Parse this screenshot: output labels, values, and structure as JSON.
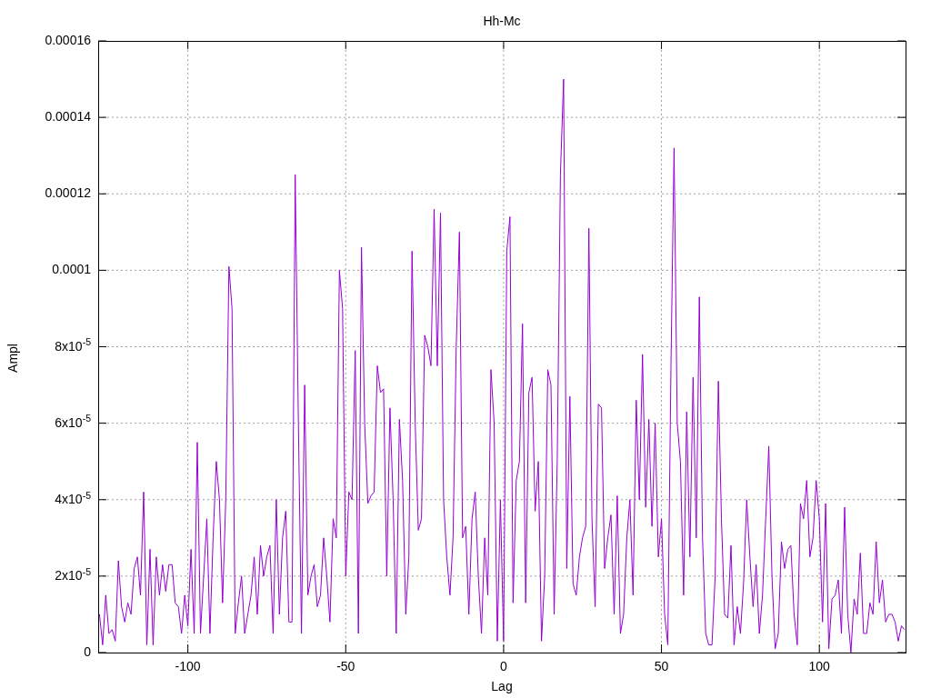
{
  "chart_data": {
    "type": "line",
    "title": "Hh-Mc",
    "xlabel": "Lag",
    "ylabel": "Ampl",
    "grid": true,
    "xlim": [
      -128,
      127
    ],
    "ylim": [
      0,
      0.00016
    ],
    "xticks": [
      -100,
      -50,
      0,
      50,
      100
    ],
    "yticks": [
      {
        "value": 0,
        "label": "0"
      },
      {
        "value": 2e-05,
        "label": "2x10$^{-5}$"
      },
      {
        "value": 4e-05,
        "label": "4x10$^{-5}$"
      },
      {
        "value": 6e-05,
        "label": "6x10$^{-5}$"
      },
      {
        "value": 8e-05,
        "label": "8x10$^{-5}$"
      },
      {
        "value": 0.0001,
        "label": "0.0001"
      },
      {
        "value": 0.00012,
        "label": "0.00012"
      },
      {
        "value": 0.00014,
        "label": "0.00014"
      },
      {
        "value": 0.00016,
        "label": "0.00016"
      }
    ],
    "x": [
      -128,
      -127,
      -126,
      -125,
      -124,
      -123,
      -122,
      -121,
      -120,
      -119,
      -118,
      -117,
      -116,
      -115,
      -114,
      -113,
      -112,
      -111,
      -110,
      -109,
      -108,
      -107,
      -106,
      -105,
      -104,
      -103,
      -102,
      -101,
      -100,
      -99,
      -98,
      -97,
      -96,
      -95,
      -94,
      -93,
      -92,
      -91,
      -90,
      -89,
      -88,
      -87,
      -86,
      -85,
      -84,
      -83,
      -82,
      -81,
      -80,
      -79,
      -78,
      -77,
      -76,
      -75,
      -74,
      -73,
      -72,
      -71,
      -70,
      -69,
      -68,
      -67,
      -66,
      -65,
      -64,
      -63,
      -62,
      -61,
      -60,
      -59,
      -58,
      -57,
      -56,
      -55,
      -54,
      -53,
      -52,
      -51,
      -50,
      -49,
      -48,
      -47,
      -46,
      -45,
      -44,
      -43,
      -42,
      -41,
      -40,
      -39,
      -38,
      -37,
      -36,
      -35,
      -34,
      -33,
      -32,
      -31,
      -30,
      -29,
      -28,
      -27,
      -26,
      -25,
      -24,
      -23,
      -22,
      -21,
      -20,
      -19,
      -18,
      -17,
      -16,
      -15,
      -14,
      -13,
      -12,
      -11,
      -10,
      -9,
      -8,
      -7,
      -6,
      -5,
      -4,
      -3,
      -2,
      -1,
      0,
      1,
      2,
      3,
      4,
      5,
      6,
      7,
      8,
      9,
      10,
      11,
      12,
      13,
      14,
      15,
      16,
      17,
      18,
      19,
      20,
      21,
      22,
      23,
      24,
      25,
      26,
      27,
      28,
      29,
      30,
      31,
      32,
      33,
      34,
      35,
      36,
      37,
      38,
      39,
      40,
      41,
      42,
      43,
      44,
      45,
      46,
      47,
      48,
      49,
      50,
      51,
      52,
      53,
      54,
      55,
      56,
      57,
      58,
      59,
      60,
      61,
      62,
      63,
      64,
      65,
      66,
      67,
      68,
      69,
      70,
      71,
      72,
      73,
      74,
      75,
      76,
      77,
      78,
      79,
      80,
      81,
      82,
      83,
      84,
      85,
      86,
      87,
      88,
      89,
      90,
      91,
      92,
      93,
      94,
      95,
      96,
      97,
      98,
      99,
      100,
      101,
      102,
      103,
      104,
      105,
      106,
      107,
      108,
      109,
      110,
      111,
      112,
      113,
      114,
      115,
      116,
      117,
      118,
      119,
      120,
      121,
      122,
      123,
      124,
      125,
      126,
      127
    ],
    "series": [
      {
        "color": "#9400d3",
        "values": [
          1e-05,
          2e-06,
          1.5e-05,
          5e-06,
          6e-06,
          3e-06,
          2.4e-05,
          1.2e-05,
          8e-06,
          1.3e-05,
          1e-05,
          2.2e-05,
          2.5e-05,
          1.5e-05,
          4.2e-05,
          2e-06,
          2.7e-05,
          2e-06,
          2.5e-05,
          1.5e-05,
          2.3e-05,
          1.6e-05,
          2.3e-05,
          2.3e-05,
          1.3e-05,
          1.2e-05,
          5e-06,
          1.5e-05,
          7e-06,
          2.7e-05,
          5e-06,
          5.5e-05,
          5e-06,
          2e-05,
          3.5e-05,
          5e-06,
          3e-05,
          5e-05,
          4e-05,
          1.3e-05,
          4e-05,
          0.000101,
          9e-05,
          5e-06,
          1.3e-05,
          2e-05,
          5e-06,
          1e-05,
          1.5e-05,
          2.5e-05,
          1e-05,
          2.8e-05,
          2e-05,
          2.5e-05,
          2.8e-05,
          5e-06,
          4e-05,
          1e-05,
          3e-05,
          3.7e-05,
          8e-06,
          8e-06,
          0.000125,
          6e-05,
          5e-06,
          7e-05,
          1.5e-05,
          2e-05,
          2.3e-05,
          1.2e-05,
          1.5e-05,
          3e-05,
          2e-05,
          8e-06,
          3.5e-05,
          3e-05,
          0.0001,
          9e-05,
          2e-05,
          4.2e-05,
          4e-05,
          7.9e-05,
          5e-06,
          0.000106,
          6e-05,
          3.9e-05,
          4.1e-05,
          4.2e-05,
          7.5e-05,
          6.8e-05,
          6.9e-05,
          2e-05,
          6.4e-05,
          4e-05,
          5e-06,
          6.1e-05,
          4.5e-05,
          1e-05,
          2.5e-05,
          0.000105,
          6e-05,
          3.2e-05,
          3.5e-05,
          8.3e-05,
          8e-05,
          7.5e-05,
          0.000116,
          7.5e-05,
          0.000115,
          4e-05,
          2.5e-05,
          1.5e-05,
          3e-05,
          8e-05,
          0.00011,
          3e-05,
          3.3e-05,
          1e-05,
          3.5e-05,
          4.2e-05,
          2e-05,
          5e-06,
          3e-05,
          1.5e-05,
          7.4e-05,
          6e-05,
          3e-06,
          4e-05,
          3e-06,
          0.000105,
          0.000114,
          1.3e-05,
          4.5e-05,
          5e-05,
          8.6e-05,
          1.3e-05,
          6.8e-05,
          7.2e-05,
          3.7e-05,
          5e-05,
          3e-06,
          2e-05,
          7.4e-05,
          7e-05,
          1e-05,
          5e-05,
          0.000125,
          0.00015,
          2.2e-05,
          6.7e-05,
          1.8e-05,
          1.5e-05,
          2.5e-05,
          3e-05,
          3.3e-05,
          0.000111,
          3.5e-05,
          1.2e-05,
          6.5e-05,
          6.4e-05,
          2.2e-05,
          3e-05,
          3.6e-05,
          1e-05,
          4.1e-05,
          5e-06,
          1e-05,
          3e-05,
          4e-05,
          1.5e-05,
          6.6e-05,
          4e-05,
          7.8e-05,
          3.8e-05,
          6.1e-05,
          3.3e-05,
          6e-05,
          2.5e-05,
          3.5e-05,
          1e-05,
          2e-06,
          7.5e-05,
          0.000132,
          6e-05,
          5e-05,
          1.5e-05,
          6.3e-05,
          2.5e-05,
          7.2e-05,
          3e-05,
          9.3e-05,
          3e-05,
          5e-06,
          2e-06,
          2e-06,
          2e-05,
          7.1e-05,
          3.5e-05,
          1e-05,
          9e-06,
          2.8e-05,
          2e-06,
          1.2e-05,
          5e-06,
          1.8e-05,
          4e-05,
          2.5e-05,
          1.2e-05,
          2.3e-05,
          5e-06,
          1.5e-05,
          3.5e-05,
          5.4e-05,
          2e-05,
          1e-06,
          5e-06,
          2.9e-05,
          2.2e-05,
          2.7e-05,
          2.8e-05,
          1e-05,
          2e-06,
          3.9e-05,
          3.5e-05,
          4.5e-05,
          2.5e-05,
          3e-05,
          4.5e-05,
          3.5e-05,
          8e-06,
          3.9e-05,
          1e-06,
          1.4e-05,
          1.5e-05,
          1.9e-05,
          5e-06,
          3.8e-05,
          1e-05,
          0,
          1.4e-05,
          1e-05,
          2.6e-05,
          5e-06,
          5e-06,
          1.3e-05,
          1e-05,
          2.9e-05,
          1.3e-05,
          1.9e-05,
          8e-06,
          1e-05,
          1e-05,
          8e-06,
          3e-06,
          7e-06,
          6e-06
        ]
      }
    ]
  }
}
